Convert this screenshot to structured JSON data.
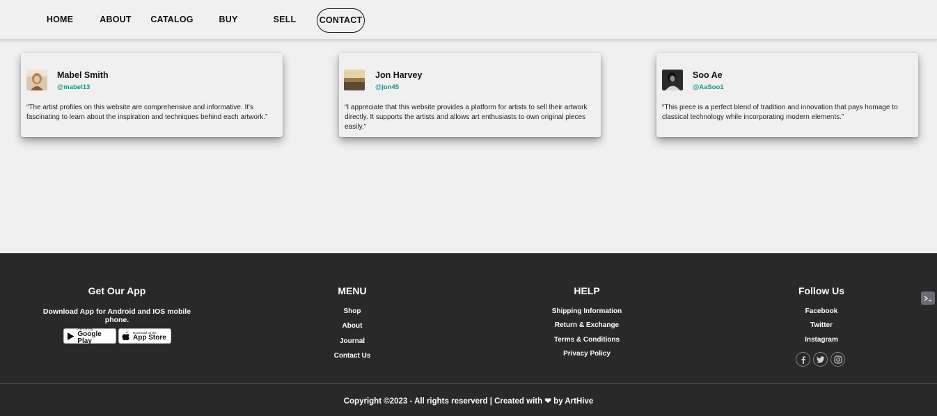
{
  "nav": {
    "items": [
      "HOME",
      "ABOUT",
      "CATALOG",
      "BUY",
      "SELL",
      "CONTACT"
    ],
    "active": "CONTACT"
  },
  "testimonials": [
    {
      "name": "Mabel Smith",
      "handle": "@mabel13",
      "quote": "“The artist profiles on this website are comprehensive and informative. It's fascinating to learn about the inspiration and techniques behind each artwork.”"
    },
    {
      "name": "Jon Harvey",
      "handle": "@jon45",
      "quote": "“I appreciate that this website provides a platform for artists to sell their artwork directly. It supports the artists and allows art enthusiasts to own original pieces easily.”"
    },
    {
      "name": "Soo Ae",
      "handle": "@AaSoo1",
      "quote": "“This piece is a perfect blend of tradition and innovation that pays homage to classical technology while incorporating modern elements.”"
    }
  ],
  "footer": {
    "app": {
      "title": "Get Our App",
      "text": "Download App for Android and IOS mobile phone.",
      "google_small": "GET IT ON",
      "google_big": "Google Play",
      "apple_small": "Download on the",
      "apple_big": "App Store"
    },
    "menu": {
      "title": "MENU",
      "links": [
        "Shop",
        "About",
        "Journal",
        "Contact Us"
      ]
    },
    "help": {
      "title": "HELP",
      "links": [
        "Shipping Information",
        "Return & Exchange",
        "Terms & Conditions",
        "Privacy Policy"
      ]
    },
    "follow": {
      "title": "Follow Us",
      "links": [
        "Facebook",
        "Twitter",
        "Instagram"
      ],
      "icons": [
        "facebook-icon",
        "twitter-icon",
        "instagram-icon"
      ]
    },
    "copyright": "Copyright ©2023 - All rights reserverd | Created with ❤ by ArtHive"
  },
  "colors": {
    "background": "#f0f0f0",
    "footer": "#292929",
    "handle": "#13958a"
  }
}
